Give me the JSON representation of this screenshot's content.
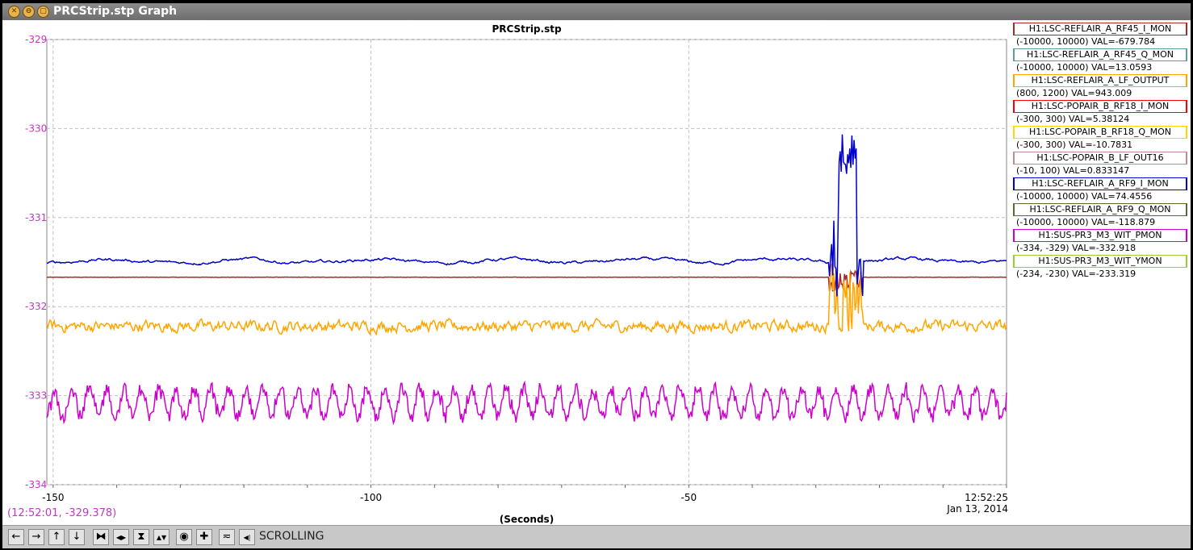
{
  "window": {
    "title": "PRCStrip.stp Graph"
  },
  "titlebar_buttons": [
    {
      "name": "close-button",
      "icon": "close-icon",
      "glyph": "✕"
    },
    {
      "name": "minimize-button",
      "icon": "minimize-icon",
      "glyph": "⊖"
    },
    {
      "name": "maximize-button",
      "icon": "maximize-icon",
      "glyph": "▢"
    }
  ],
  "coords_readout": "(12:52:01, -329.378)",
  "toolbar": {
    "buttons": [
      {
        "name": "scroll-left-button",
        "icon": "arrow-left-icon",
        "glyph": "←"
      },
      {
        "name": "scroll-right-button",
        "icon": "arrow-right-icon",
        "glyph": "→"
      },
      {
        "name": "scroll-up-button",
        "icon": "arrow-up-icon",
        "glyph": "↑"
      },
      {
        "name": "scroll-down-button",
        "icon": "arrow-down-icon",
        "glyph": "↓"
      },
      {
        "name": "zoom-in-x-button",
        "icon": "zoom-in-x-icon",
        "glyph": "⧓"
      },
      {
        "name": "zoom-out-x-button",
        "icon": "zoom-out-x-icon",
        "glyph": "◀▶"
      },
      {
        "name": "zoom-in-y-button",
        "icon": "zoom-in-y-icon",
        "glyph": "⧗"
      },
      {
        "name": "zoom-out-y-button",
        "icon": "zoom-out-y-icon",
        "glyph": "▲▼"
      },
      {
        "name": "zoom-box-button",
        "icon": "zoom-box-icon",
        "glyph": "◉"
      },
      {
        "name": "auto-scale-button",
        "icon": "plus-icon",
        "glyph": "✚"
      },
      {
        "name": "pan-button",
        "icon": "pan-icon",
        "glyph": "≂"
      },
      {
        "name": "scrolling-toggle-button",
        "icon": "scroll-toggle-icon",
        "glyph": "◀|"
      }
    ],
    "mode_label": "SCROLLING"
  },
  "chart_data": {
    "type": "line",
    "title": "PRCStrip.stp",
    "xlabel": "(Seconds)",
    "ylabel": "",
    "xlim": [
      -151,
      0
    ],
    "ylim": [
      -334,
      -329
    ],
    "x_ticks": [
      -150,
      -100,
      -50
    ],
    "x_end_label": [
      "12:52:25",
      "Jan 13, 2014"
    ],
    "y_ticks": [
      -329,
      -330,
      -331,
      -332,
      -333,
      -334
    ],
    "axis_color": "#c436c4",
    "grid": true,
    "series": [
      {
        "name": "H1:LSC-REFLAIR_A_RF45_I_MON",
        "range": "(-10000, 10000) VAL=-679.784",
        "color": "#a52a2a",
        "kind": "flat",
        "level": -331.67,
        "noise": 0.005,
        "wide_scale": 1,
        "burst": "brown"
      },
      {
        "name": "H1:LSC-REFLAIR_A_RF45_Q_MON",
        "range": "(-10000, 10000) VAL=13.0593",
        "color": "#5f9ea0",
        "kind": "none"
      },
      {
        "name": "H1:LSC-REFLAIR_A_LF_OUTPUT",
        "range": "(800, 1200) VAL=943.009",
        "color": "#ffa500",
        "kind": "noisy",
        "level": -332.22,
        "noise": 0.07,
        "wide_scale": 1,
        "burst": "orange"
      },
      {
        "name": "H1:LSC-POPAIR_B_RF18_I_MON",
        "range": "(-300, 300) VAL=5.38124",
        "color": "#ff0000",
        "kind": "none"
      },
      {
        "name": "H1:LSC-POPAIR_B_RF18_Q_MON",
        "range": "(-300, 300) VAL=-10.7831",
        "color": "#ffd700",
        "kind": "none"
      },
      {
        "name": "H1:LSC-POPAIR_B_LF_OUT16",
        "range": "(-10, 100) VAL=0.833147",
        "color": "#bc8f8f",
        "kind": "none"
      },
      {
        "name": "H1:LSC-REFLAIR_A_RF9_I_MON",
        "range": "(-10000, 10000) VAL=74.4556",
        "color": "#0000cd",
        "kind": "smooth",
        "level": -331.49,
        "noise": 0.02,
        "wide_scale": 1,
        "burst": "blue"
      },
      {
        "name": "H1:LSC-REFLAIR_A_RF9_Q_MON",
        "range": "(-10000, 10000) VAL=-118.879",
        "color": "#556b2f",
        "kind": "none"
      },
      {
        "name": "H1:SUS-PR3_M3_WIT_PMON",
        "range": "(-334, -329) VAL=-332.918",
        "color": "#cc00cc",
        "kind": "oscillating",
        "level": -333.08,
        "noise": 0.16,
        "wide_scale": 1,
        "burst": "none"
      },
      {
        "name": "H1:SUS-PR3_M3_WIT_YMON",
        "range": "(-234, -230) VAL=-233.319",
        "color": "#9acd32",
        "kind": "none"
      }
    ]
  }
}
